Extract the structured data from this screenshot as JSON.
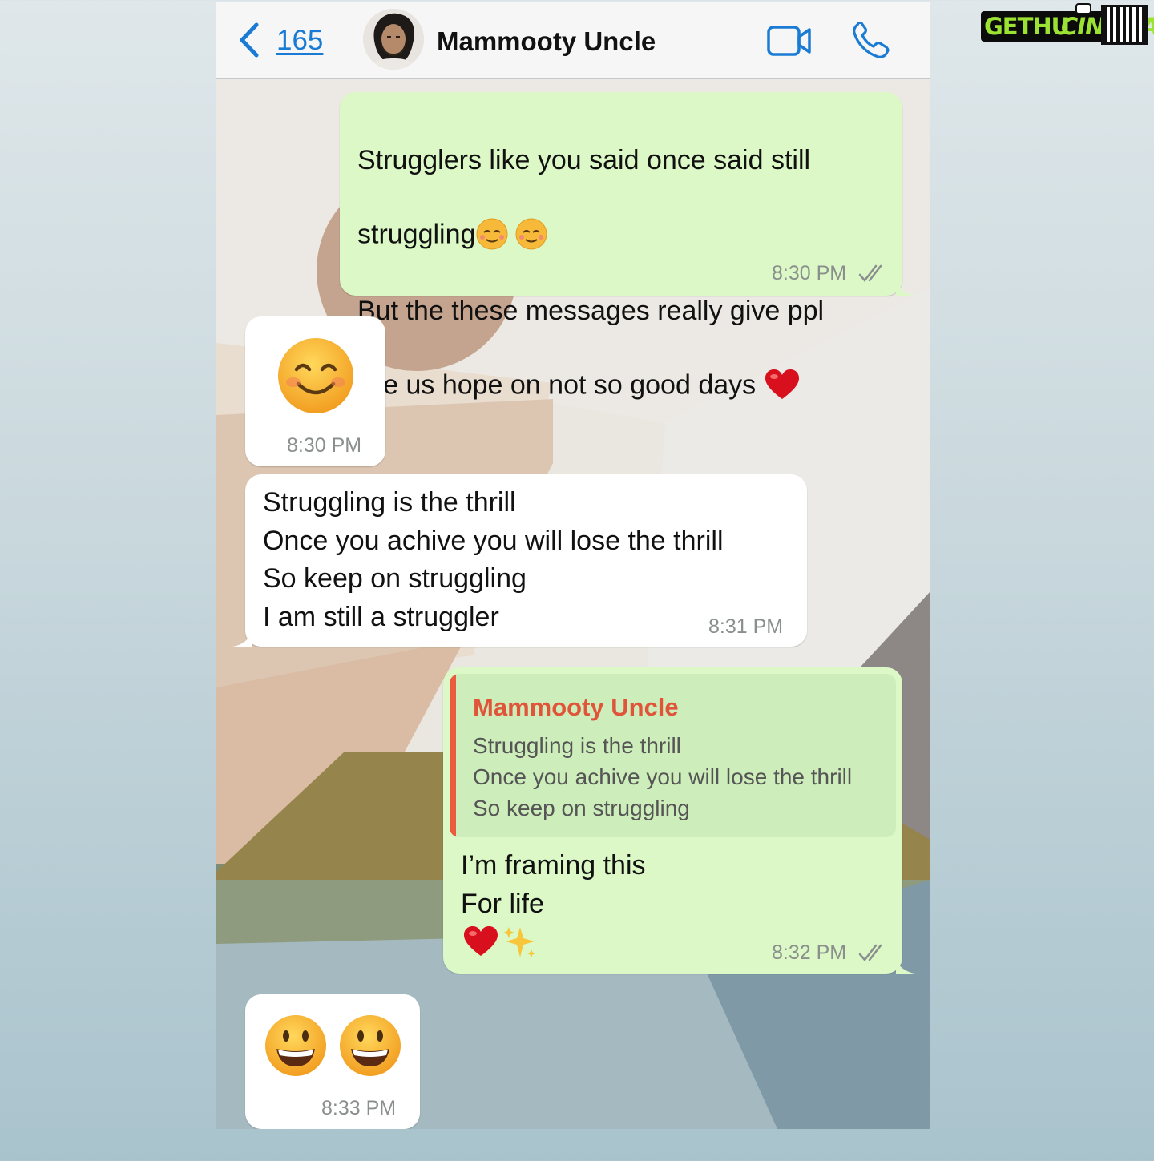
{
  "watermark": {
    "word1": "GETHU",
    "word2": "CINEMA"
  },
  "header": {
    "back_count": "165",
    "contact_name": "Mammooty Uncle"
  },
  "colors": {
    "outgoing_bubble": "#dcf8c6",
    "incoming_bubble": "#ffffff",
    "accent_blue": "#1a7bd5",
    "quote_accent": "#e85d3f"
  },
  "messages": [
    {
      "direction": "outgoing",
      "text": "Strugglers like you said once said still\nstruggling",
      "text2": "But the these messages really give ppl\nlike us hope on not so good days",
      "time": "8:30 PM",
      "icons": [
        "relieved-face-emoji",
        "relieved-face-emoji",
        "red-heart-emoji"
      ]
    },
    {
      "direction": "incoming",
      "icons": [
        "smiling-face-emoji"
      ],
      "time": "8:30 PM"
    },
    {
      "direction": "incoming",
      "text": "Struggling is the thrill\nOnce you achive you will lose the thrill\nSo keep on struggling\nI am still a struggler",
      "time": "8:31 PM"
    },
    {
      "direction": "outgoing",
      "quote": {
        "author": "Mammooty Uncle",
        "text": "Struggling is the thrill\nOnce you achive you will lose the thrill\nSo keep on struggling"
      },
      "text": "I’m framing this\nFor life",
      "icons": [
        "red-heart-emoji",
        "sparkles-emoji"
      ],
      "time": "8:32 PM"
    },
    {
      "direction": "incoming",
      "icons": [
        "grinning-face-emoji",
        "grinning-face-emoji"
      ],
      "time": "8:33 PM"
    }
  ]
}
